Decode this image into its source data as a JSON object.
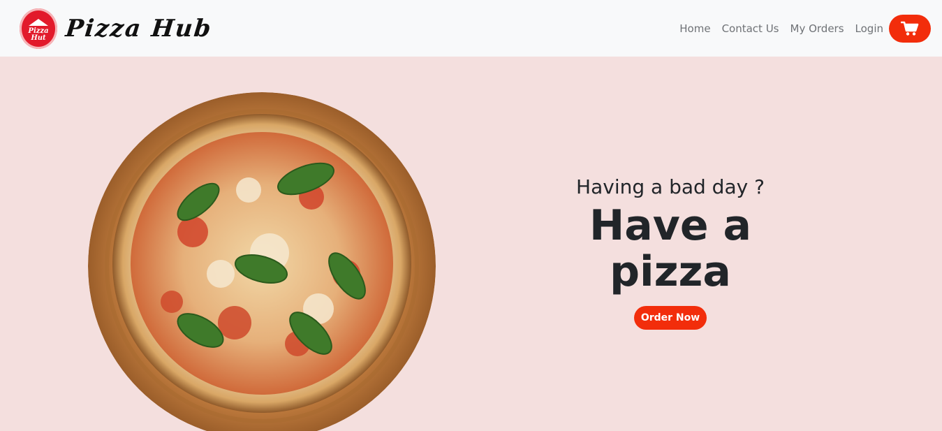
{
  "navbar": {
    "brand_name": "Pizza Hub",
    "logo_text": "Pizza Hut",
    "links": [
      {
        "label": "Home"
      },
      {
        "label": "Contact Us"
      },
      {
        "label": "My Orders"
      },
      {
        "label": "Login"
      }
    ],
    "cart_icon": "shopping-cart-icon"
  },
  "hero": {
    "tagline": "Having a bad day ?",
    "headline": "Have a pizza",
    "cta_label": "Order Now"
  },
  "colors": {
    "accent": "#f22d0b",
    "navbar_bg": "#f8f9fa",
    "hero_bg": "#f4dfde",
    "text_dark": "#212529",
    "nav_text": "#6f7276"
  }
}
